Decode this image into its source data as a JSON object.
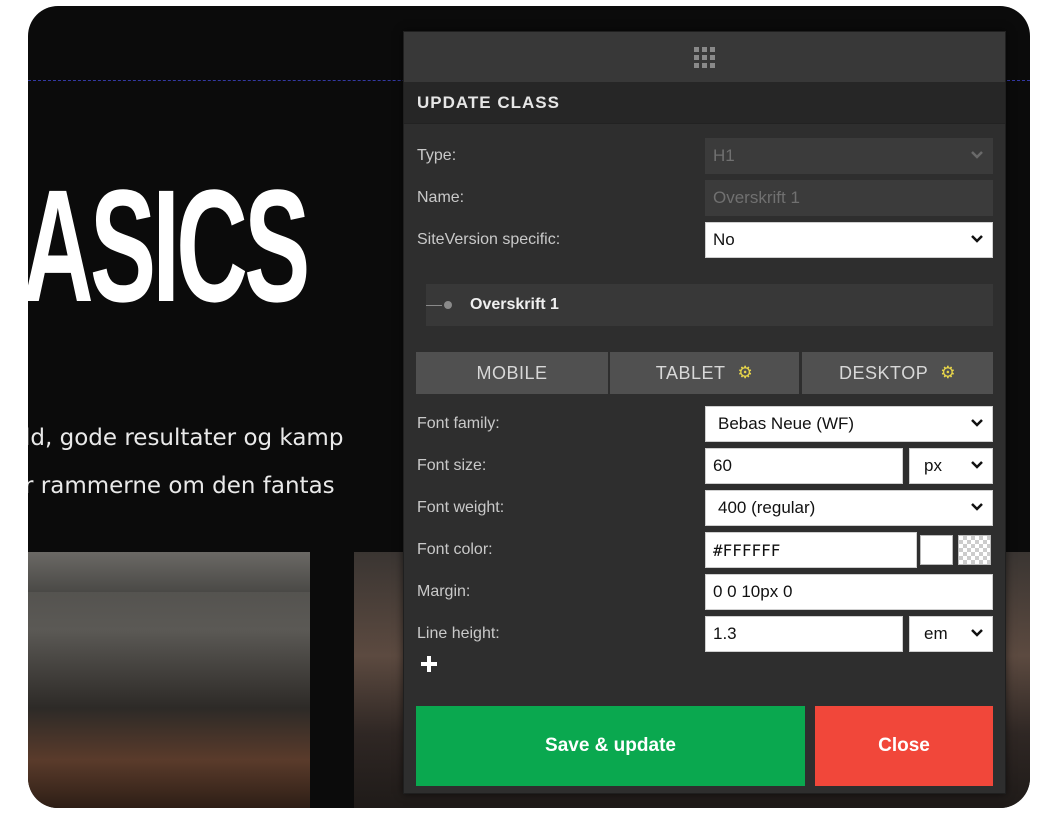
{
  "background": {
    "hero_title": "ASICS",
    "text_line_1": "ld, gode resultater og kamp",
    "text_line_2": "r rammerne om den fantas"
  },
  "panel": {
    "header": "UPDATE CLASS",
    "type": {
      "label": "Type:",
      "value": "H1"
    },
    "name": {
      "label": "Name:",
      "value": "Overskrift 1"
    },
    "siteversion": {
      "label": "SiteVersion specific:",
      "value": "No"
    },
    "tree_item": "Overskrift 1",
    "tabs": [
      {
        "label": "MOBILE",
        "has_gear": false
      },
      {
        "label": "TABLET",
        "has_gear": true
      },
      {
        "label": "DESKTOP",
        "has_gear": true
      }
    ],
    "font_family": {
      "label": "Font family:",
      "value": "Bebas Neue (WF)"
    },
    "font_size": {
      "label": "Font size:",
      "value": "60",
      "unit": "px"
    },
    "font_weight": {
      "label": "Font weight:",
      "value": "400 (regular)"
    },
    "font_color": {
      "label": "Font color:",
      "value": "#FFFFFF"
    },
    "margin": {
      "label": "Margin:",
      "value": "0 0 10px 0"
    },
    "line_height": {
      "label": "Line height:",
      "value": "1.3",
      "unit": "em"
    },
    "save_label": "Save & update",
    "close_label": "Close"
  },
  "colors": {
    "save": "#0aa84f",
    "close": "#f1473a",
    "gear": "#e8d64a"
  }
}
